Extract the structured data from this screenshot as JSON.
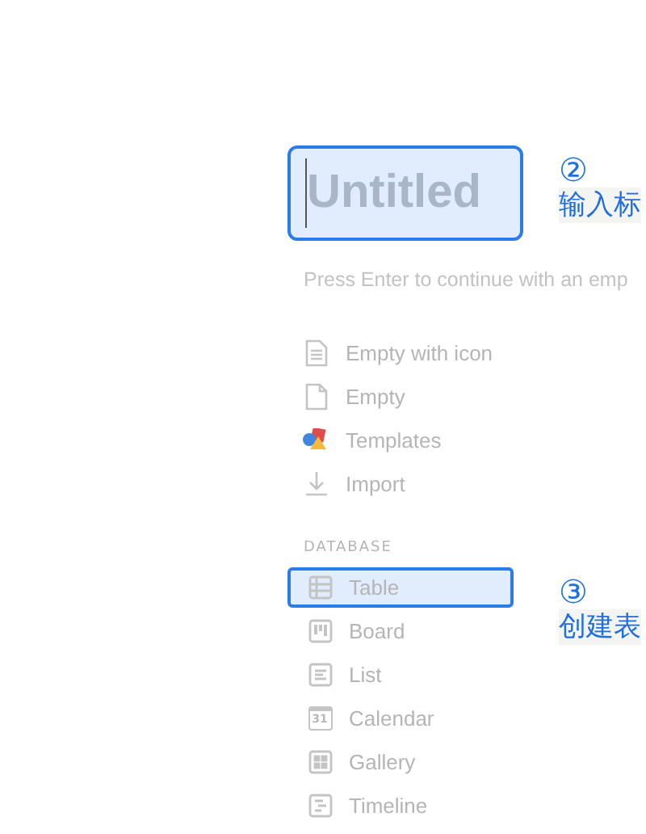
{
  "title_field": {
    "placeholder": "Untitled",
    "highlighted": true
  },
  "title_note": {
    "number": "②",
    "text": "输入标"
  },
  "hint": "Press Enter to continue with an emp",
  "page_options": [
    {
      "kind": "doc-lines",
      "label": "Empty with icon"
    },
    {
      "kind": "doc",
      "label": "Empty"
    },
    {
      "kind": "shapes",
      "label": "Templates"
    },
    {
      "kind": "download",
      "label": "Import"
    }
  ],
  "database": {
    "heading": "DATABASE",
    "items": [
      {
        "kind": "table",
        "label": "Table",
        "selected": true
      },
      {
        "kind": "board",
        "label": "Board",
        "selected": false
      },
      {
        "kind": "list",
        "label": "List",
        "selected": false
      },
      {
        "kind": "calendar",
        "label": "Calendar",
        "selected": false,
        "icon_text": "31"
      },
      {
        "kind": "gallery",
        "label": "Gallery",
        "selected": false
      },
      {
        "kind": "timeline",
        "label": "Timeline",
        "selected": false
      }
    ]
  },
  "table_note": {
    "number": "③",
    "text": "创建表"
  }
}
